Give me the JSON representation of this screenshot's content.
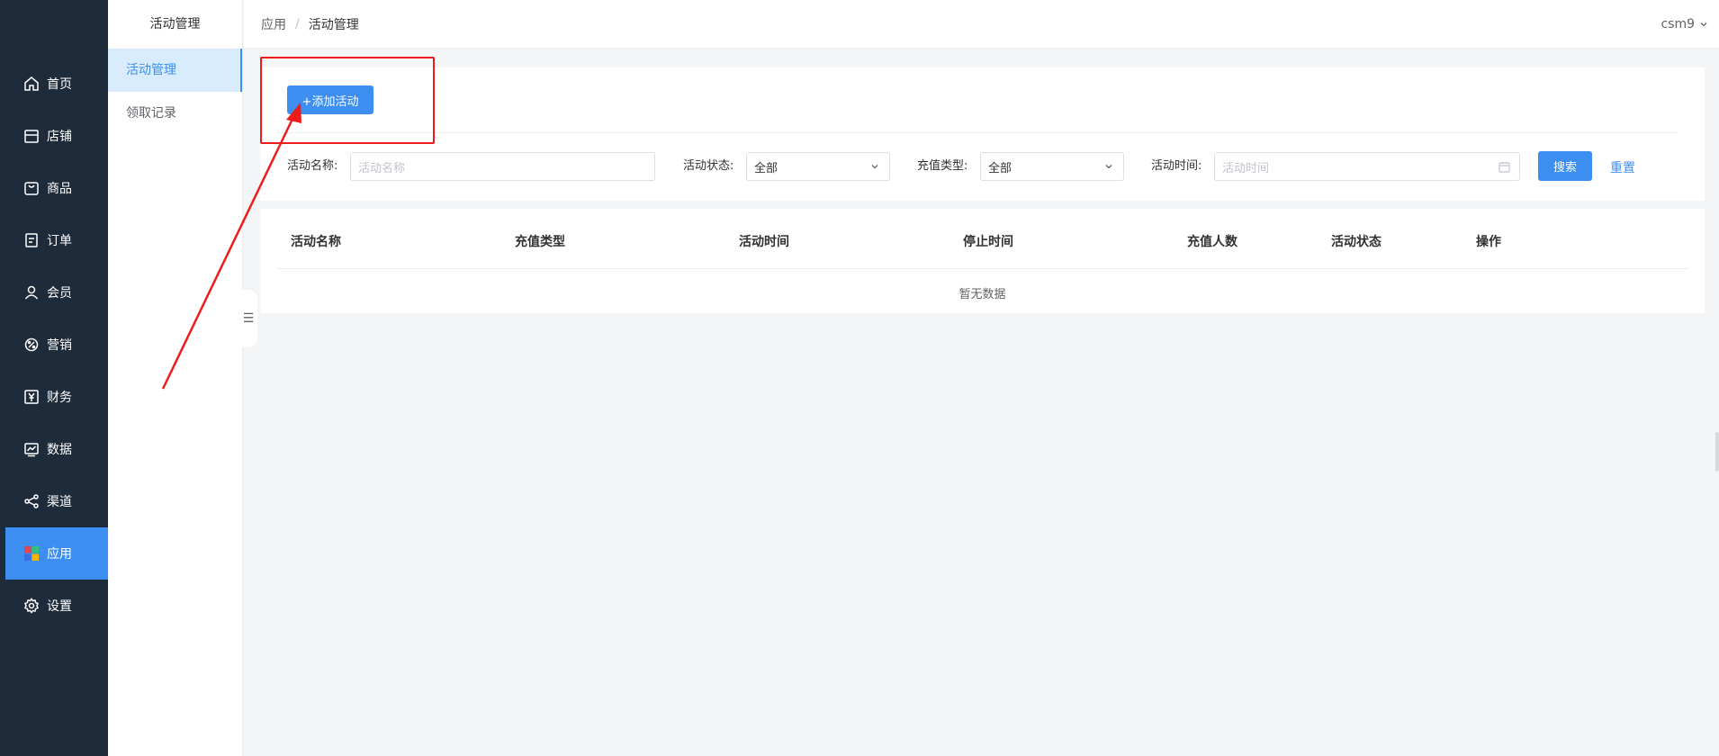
{
  "nav": {
    "items": [
      {
        "label": "首页",
        "icon": "home-icon"
      },
      {
        "label": "店铺",
        "icon": "store-icon"
      },
      {
        "label": "商品",
        "icon": "bag-icon"
      },
      {
        "label": "订单",
        "icon": "order-icon"
      },
      {
        "label": "会员",
        "icon": "user-icon"
      },
      {
        "label": "营销",
        "icon": "marketing-icon"
      },
      {
        "label": "财务",
        "icon": "yen-icon"
      },
      {
        "label": "数据",
        "icon": "chart-icon"
      },
      {
        "label": "渠道",
        "icon": "share-icon"
      },
      {
        "label": "应用",
        "icon": "apps-icon"
      },
      {
        "label": "设置",
        "icon": "gear-icon"
      }
    ],
    "active_label": "应用"
  },
  "subnav": {
    "title": "活动管理",
    "items": [
      {
        "label": "活动管理"
      },
      {
        "label": "领取记录"
      }
    ],
    "active_label": "活动管理"
  },
  "header": {
    "breadcrumb": [
      "应用",
      "活动管理"
    ],
    "separator": "/",
    "user": "csm9"
  },
  "toolbar": {
    "add_label": "+添加活动"
  },
  "filters": {
    "name_label": "活动名称:",
    "name_placeholder": "活动名称",
    "status_label": "活动状态:",
    "status_value": "全部",
    "type_label": "充值类型:",
    "type_value": "全部",
    "time_label": "活动时间:",
    "time_placeholder": "活动时间",
    "search_label": "搜索",
    "reset_label": "重置"
  },
  "table": {
    "columns": [
      "活动名称",
      "充值类型",
      "活动时间",
      "停止时间",
      "充值人数",
      "活动状态",
      "操作"
    ],
    "rows": [],
    "empty_text": "暂无数据"
  },
  "colors": {
    "sidebar_bg": "#1e2b3a",
    "accent": "#3c8ff0",
    "annotation": "#ee1b1b"
  }
}
